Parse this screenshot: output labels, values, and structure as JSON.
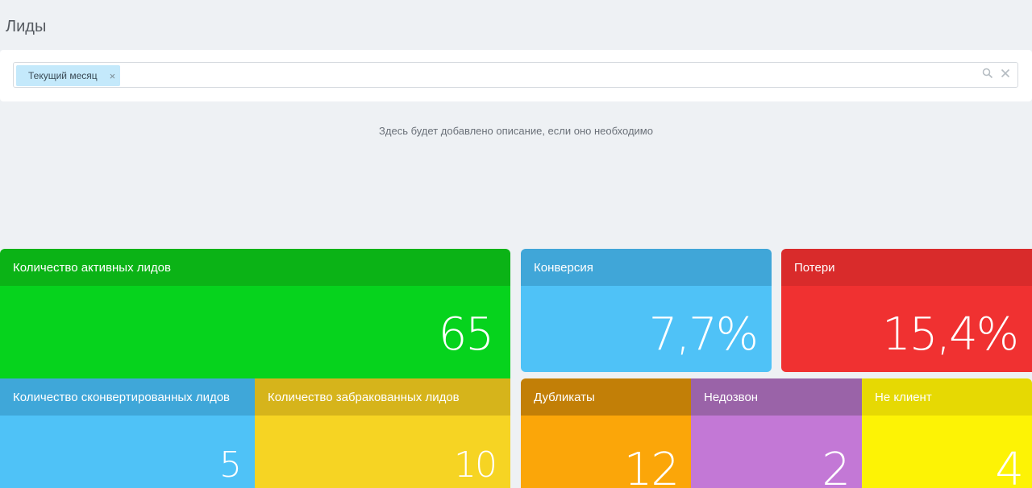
{
  "page": {
    "title": "Лиды",
    "description": "Здесь будет добавлено описание, если оно необходимо"
  },
  "filter": {
    "tag_label": "Текущий месяц",
    "tag_remove_symbol": "×",
    "icons": [
      "search-icon",
      "clear-icon"
    ]
  },
  "tiles": {
    "active": {
      "title": "Количество активных лидов",
      "value": "65"
    },
    "converted": {
      "title": "Количество сконвертированных лидов",
      "value": "5"
    },
    "rejected": {
      "title": "Количество забракованных лидов",
      "value": "10"
    },
    "conversion": {
      "title": "Конверсия",
      "value": "7,7%"
    },
    "losses": {
      "title": "Потери",
      "value": "15,4%"
    },
    "duplicates": {
      "title": "Дубликаты",
      "value": "12"
    },
    "noanswer": {
      "title": "Недозвон",
      "value": "2"
    },
    "notclient": {
      "title": "Не клиент",
      "value": "4"
    }
  },
  "colors": {
    "background": "#eef1f4",
    "green": "#06d31d",
    "blue": "#4fc2f7",
    "yellow": "#f6d423",
    "red": "#f03131",
    "orange": "#fba609",
    "purple": "#c378d6",
    "lemon": "#fdf305",
    "tag": "#c4e9fb"
  }
}
